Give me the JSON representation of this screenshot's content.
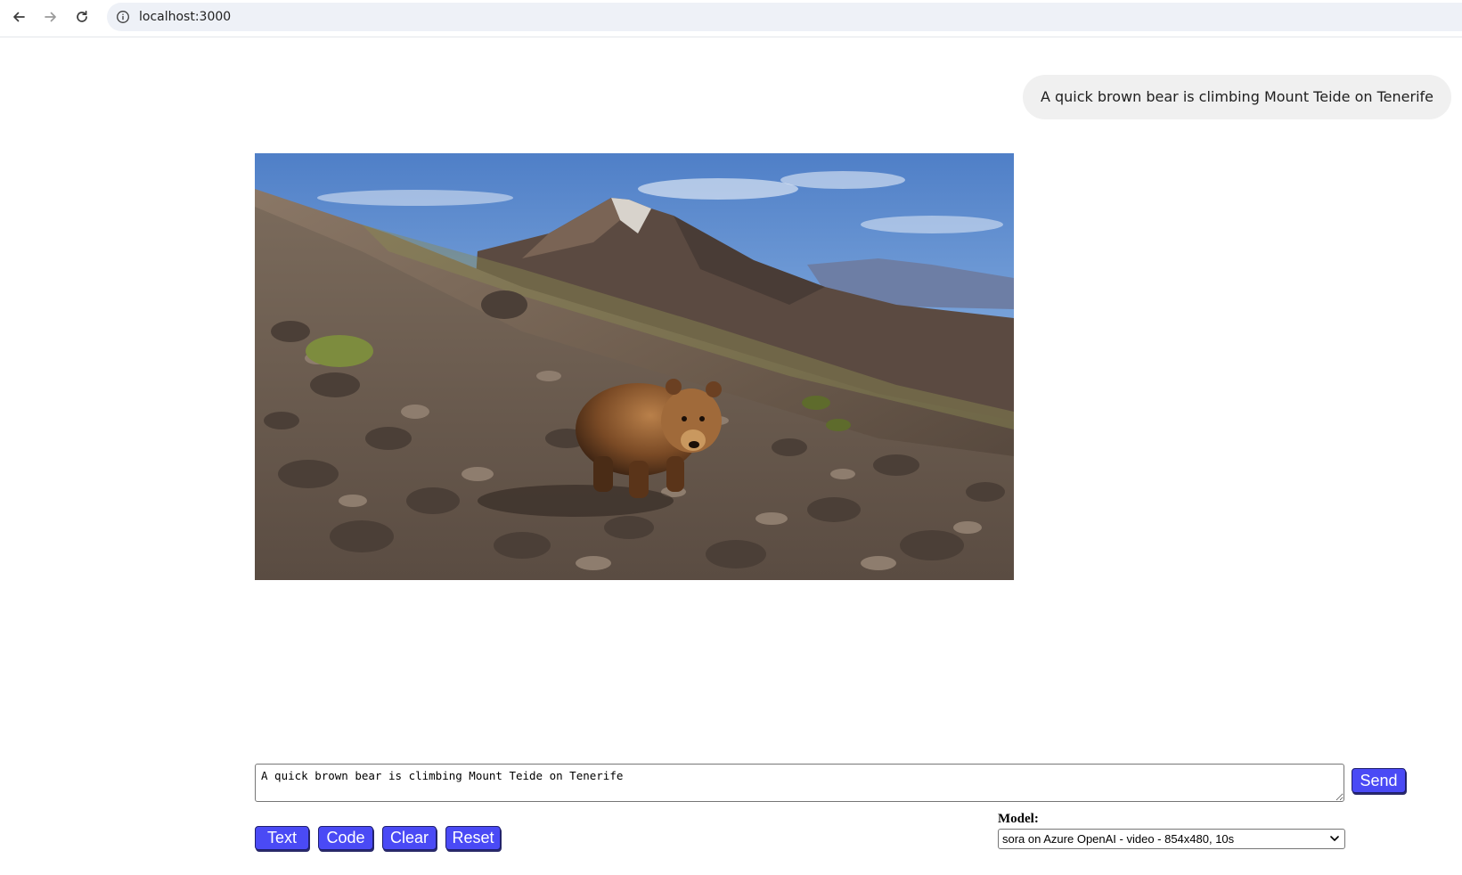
{
  "browser": {
    "url": "localhost:3000",
    "icons": {
      "back": "arrow-left-icon",
      "forward": "arrow-right-icon",
      "reload": "reload-icon",
      "site_info": "info-circle-icon"
    }
  },
  "chat": {
    "user_message": "A quick brown bear is climbing Mount Teide on Tenerife",
    "generated_media": {
      "type": "video"
    }
  },
  "composer": {
    "prompt_value": "A quick brown bear is climbing Mount Teide on Tenerife",
    "send_label": "Send",
    "buttons": {
      "text": "Text",
      "code": "Code",
      "clear": "Clear",
      "reset": "Reset"
    },
    "model_label": "Model:",
    "model_selected": "sora on Azure OpenAI - video - 854x480, 10s"
  },
  "colors": {
    "button_bg": "#4a4af5",
    "bubble_bg": "#f0f0f0",
    "omnibox_bg": "#eef1f7"
  }
}
